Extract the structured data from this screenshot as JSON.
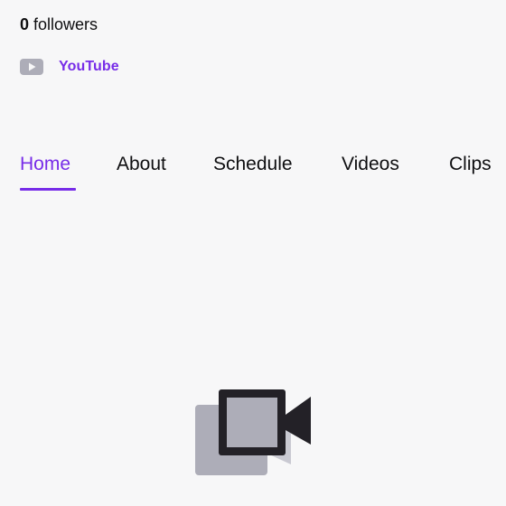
{
  "profile": {
    "followers_count": "0",
    "followers_label": " followers"
  },
  "social": {
    "label": "YouTube",
    "icon": "youtube-icon"
  },
  "tabs": [
    {
      "label": "Home",
      "active": true
    },
    {
      "label": "About",
      "active": false
    },
    {
      "label": "Schedule",
      "active": false
    },
    {
      "label": "Videos",
      "active": false
    },
    {
      "label": "Clips",
      "active": false
    }
  ],
  "illustration": {
    "icon": "video-camera-icon"
  },
  "colors": {
    "accent": "#772ce8",
    "background": "#f7f7f8",
    "text": "#0e0e10",
    "icon_muted": "#adadb8",
    "icon_dark": "#232127"
  }
}
